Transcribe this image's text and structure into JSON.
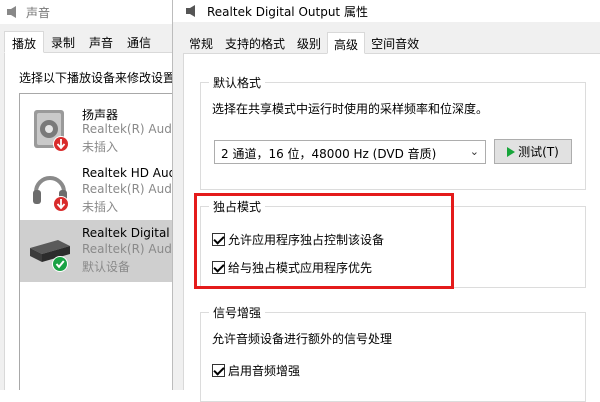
{
  "sound_window": {
    "title": "声音",
    "tabs": [
      "播放",
      "录制",
      "声音",
      "通信"
    ],
    "active_tab": 0,
    "instruction": "选择以下播放设备来修改设置:",
    "devices": [
      {
        "name": "扬声器",
        "driver": "Realtek(R) Audio",
        "status": "未插入",
        "icon": "speaker-icon",
        "badge": "unplugged-badge-icon",
        "selected": false
      },
      {
        "name": "Realtek HD Audio",
        "driver": "Realtek(R) Audio",
        "status": "未插入",
        "icon": "headphones-icon",
        "badge": "unplugged-badge-icon",
        "selected": false
      },
      {
        "name": "Realtek Digital Ou",
        "driver": "Realtek(R) Audio",
        "status": "默认设备",
        "icon": "digital-output-icon",
        "badge": "default-check-badge-icon",
        "selected": true
      }
    ]
  },
  "props_window": {
    "title": "Realtek Digital Output 属性",
    "tabs": [
      "常规",
      "支持的格式",
      "级别",
      "高级",
      "空间音效"
    ],
    "active_tab": 3,
    "default_format": {
      "group_label": "默认格式",
      "description": "选择在共享模式中运行时使用的采样频率和位深度。",
      "selected_format": "2 通道，16 位，48000 Hz (DVD 音质)",
      "test_button": "测试(T)"
    },
    "exclusive_mode": {
      "group_label": "独占模式",
      "option1": {
        "label": "允许应用程序独占控制该设备",
        "checked": true
      },
      "option2": {
        "label": "给与独占模式应用程序优先",
        "checked": true
      }
    },
    "signal_enhancement": {
      "group_label": "信号增强",
      "description": "允许音频设备进行额外的信号处理",
      "option": {
        "label": "启用音频增强",
        "checked": true
      }
    }
  },
  "colors": {
    "highlight": "#e41b1b",
    "play": "#17a53a",
    "selected_row": "#cfcfcf"
  }
}
